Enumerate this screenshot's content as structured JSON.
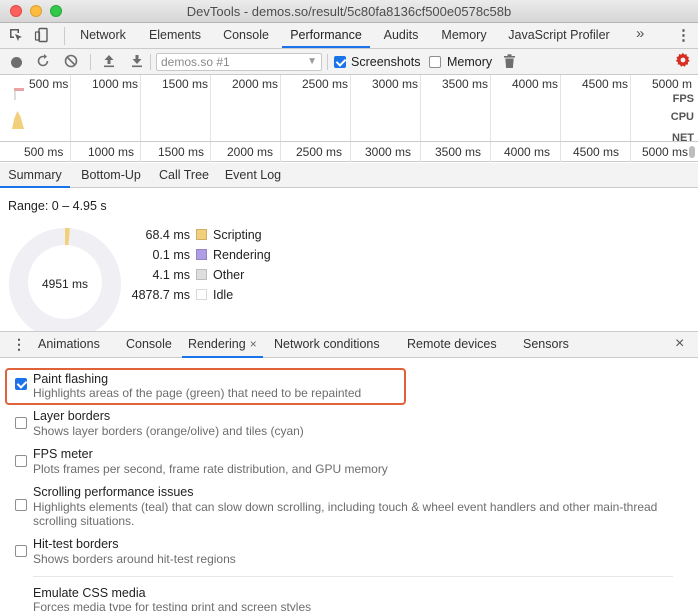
{
  "window": {
    "title": "DevTools - demos.so/result/5c80fa8136cf500e0578c58b"
  },
  "main_tabs": [
    {
      "label": "Network"
    },
    {
      "label": "Elements"
    },
    {
      "label": "Console"
    },
    {
      "label": "Performance"
    },
    {
      "label": "Audits"
    },
    {
      "label": "Memory"
    },
    {
      "label": "JavaScript Profiler"
    }
  ],
  "main_tabs_more": "»",
  "perf_toolbar": {
    "profile_select": "demos.so #1",
    "screenshots_label": "Screenshots",
    "screenshots_checked": true,
    "memory_label": "Memory",
    "memory_checked": false
  },
  "overview": {
    "ticks": [
      "500 ms",
      "1000 ms",
      "1500 ms",
      "2000 ms",
      "2500 ms",
      "3000 ms",
      "3500 ms",
      "4000 ms",
      "4500 ms",
      "5000 m"
    ],
    "track_labels": [
      "FPS",
      "CPU",
      "NET"
    ]
  },
  "ruler": {
    "ticks": [
      "500 ms",
      "1000 ms",
      "1500 ms",
      "2000 ms",
      "2500 ms",
      "3000 ms",
      "3500 ms",
      "4000 ms",
      "4500 ms",
      "5000 ms"
    ]
  },
  "sub_tabs": [
    {
      "label": "Summary"
    },
    {
      "label": "Bottom-Up"
    },
    {
      "label": "Call Tree"
    },
    {
      "label": "Event Log"
    }
  ],
  "summary": {
    "range": "Range: 0 – 4.95 s",
    "total": "4951 ms",
    "legend": [
      {
        "value": "68.4 ms",
        "name": "Scripting",
        "color": "#f2cf7a"
      },
      {
        "value": "0.1 ms",
        "name": "Rendering",
        "color": "#af9ee6"
      },
      {
        "value": "4.1 ms",
        "name": "Other",
        "color": "#dedede"
      },
      {
        "value": "4878.7 ms",
        "name": "Idle",
        "color": "#ffffff"
      }
    ]
  },
  "drawer_tabs": [
    {
      "label": "Animations"
    },
    {
      "label": "Console"
    },
    {
      "label": "Rendering",
      "close": "×"
    },
    {
      "label": "Network conditions"
    },
    {
      "label": "Remote devices"
    },
    {
      "label": "Sensors"
    }
  ],
  "drawer_close": "×",
  "rendering_options": [
    {
      "title": "Paint flashing",
      "desc": "Highlights areas of the page (green) that need to be repainted",
      "checked": true
    },
    {
      "title": "Layer borders",
      "desc": "Shows layer borders (orange/olive) and tiles (cyan)",
      "checked": false
    },
    {
      "title": "FPS meter",
      "desc": "Plots frames per second, frame rate distribution, and GPU memory",
      "checked": false
    },
    {
      "title": "Scrolling performance issues",
      "desc": "Highlights elements (teal) that can slow down scrolling, including touch & wheel event handlers and other main-thread scrolling situations.",
      "checked": false
    },
    {
      "title": "Hit-test borders",
      "desc": "Shows borders around hit-test regions",
      "checked": false
    },
    {
      "title": "Emulate CSS media",
      "desc": "Forces media type for testing print and screen styles"
    }
  ],
  "colors": {
    "accent": "#1a73e8",
    "highlight_box": "#e0623a",
    "gear": "#d62d20"
  }
}
